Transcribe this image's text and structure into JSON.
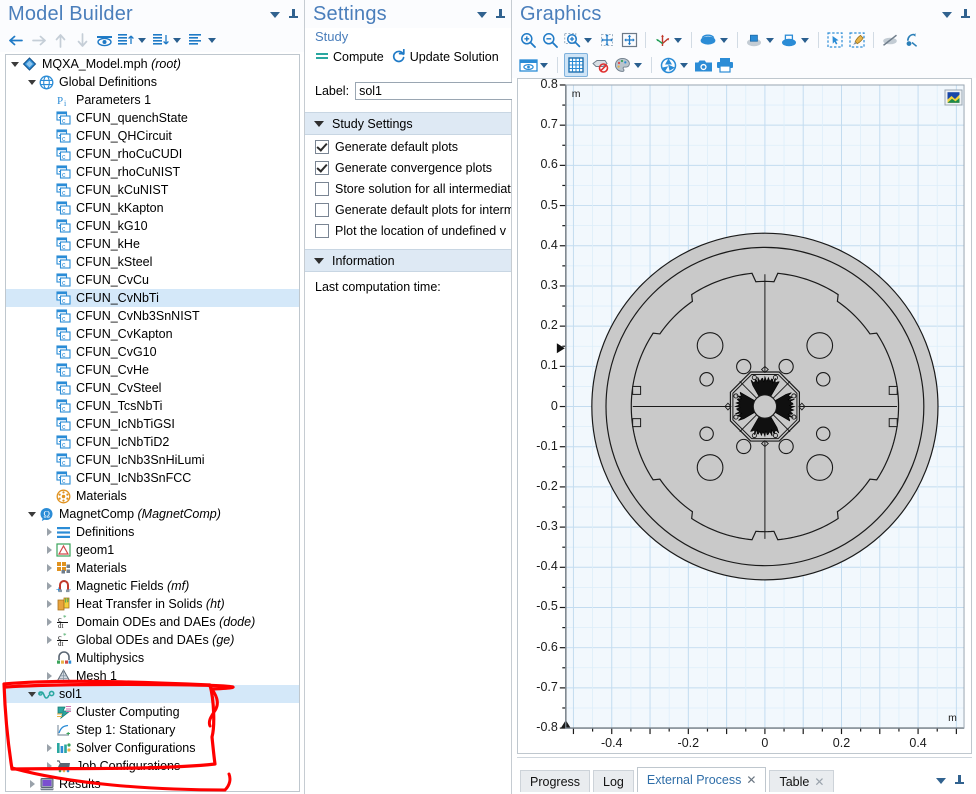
{
  "model_builder": {
    "title": "Model Builder",
    "toolbar": [
      {
        "name": "back-button",
        "icon": "arrow-left-icon"
      },
      {
        "name": "forward-button",
        "icon": "arrow-right-icon"
      },
      {
        "name": "move-up-button",
        "icon": "arrow-up-icon"
      },
      {
        "name": "move-down-button",
        "icon": "arrow-down-icon"
      },
      {
        "name": "show-hide-button",
        "icon": "eye-icon"
      },
      {
        "name": "collapse-tree-button",
        "icon": "collapse-up-icon"
      },
      {
        "name": "expand-tree-button",
        "icon": "expand-down-icon"
      },
      {
        "name": "tree-options-button",
        "icon": "list-icon"
      }
    ],
    "tree": [
      {
        "label": "MQXA_Model.mph",
        "suffix": "(root)",
        "depth": 0,
        "expander": "down",
        "icon": "root-diamond-icon",
        "selected": false
      },
      {
        "label": "Global Definitions",
        "suffix": "",
        "depth": 1,
        "expander": "down",
        "icon": "globe-icon",
        "selected": false
      },
      {
        "label": "Parameters 1",
        "suffix": "",
        "depth": 2,
        "expander": "none",
        "icon": "parameters-icon",
        "selected": false
      },
      {
        "label": "CFUN_quenchState",
        "suffix": "",
        "depth": 2,
        "expander": "none",
        "icon": "function-icon",
        "selected": false
      },
      {
        "label": "CFUN_QHCircuit",
        "suffix": "",
        "depth": 2,
        "expander": "none",
        "icon": "function-icon",
        "selected": false
      },
      {
        "label": "CFUN_rhoCuCUDI",
        "suffix": "",
        "depth": 2,
        "expander": "none",
        "icon": "function-icon",
        "selected": false
      },
      {
        "label": "CFUN_rhoCuNIST",
        "suffix": "",
        "depth": 2,
        "expander": "none",
        "icon": "function-icon",
        "selected": false
      },
      {
        "label": "CFUN_kCuNIST",
        "suffix": "",
        "depth": 2,
        "expander": "none",
        "icon": "function-icon",
        "selected": false
      },
      {
        "label": "CFUN_kKapton",
        "suffix": "",
        "depth": 2,
        "expander": "none",
        "icon": "function-icon",
        "selected": false
      },
      {
        "label": "CFUN_kG10",
        "suffix": "",
        "depth": 2,
        "expander": "none",
        "icon": "function-icon",
        "selected": false
      },
      {
        "label": "CFUN_kHe",
        "suffix": "",
        "depth": 2,
        "expander": "none",
        "icon": "function-icon",
        "selected": false
      },
      {
        "label": "CFUN_kSteel",
        "suffix": "",
        "depth": 2,
        "expander": "none",
        "icon": "function-icon",
        "selected": false
      },
      {
        "label": "CFUN_CvCu",
        "suffix": "",
        "depth": 2,
        "expander": "none",
        "icon": "function-icon",
        "selected": false
      },
      {
        "label": "CFUN_CvNbTi",
        "suffix": "",
        "depth": 2,
        "expander": "none",
        "icon": "function-icon",
        "selected": true
      },
      {
        "label": "CFUN_CvNb3SnNIST",
        "suffix": "",
        "depth": 2,
        "expander": "none",
        "icon": "function-icon",
        "selected": false
      },
      {
        "label": "CFUN_CvKapton",
        "suffix": "",
        "depth": 2,
        "expander": "none",
        "icon": "function-icon",
        "selected": false
      },
      {
        "label": "CFUN_CvG10",
        "suffix": "",
        "depth": 2,
        "expander": "none",
        "icon": "function-icon",
        "selected": false
      },
      {
        "label": "CFUN_CvHe",
        "suffix": "",
        "depth": 2,
        "expander": "none",
        "icon": "function-icon",
        "selected": false
      },
      {
        "label": "CFUN_CvSteel",
        "suffix": "",
        "depth": 2,
        "expander": "none",
        "icon": "function-icon",
        "selected": false
      },
      {
        "label": "CFUN_TcsNbTi",
        "suffix": "",
        "depth": 2,
        "expander": "none",
        "icon": "function-icon",
        "selected": false
      },
      {
        "label": "CFUN_IcNbTiGSI",
        "suffix": "",
        "depth": 2,
        "expander": "none",
        "icon": "function-icon",
        "selected": false
      },
      {
        "label": "CFUN_IcNbTiD2",
        "suffix": "",
        "depth": 2,
        "expander": "none",
        "icon": "function-icon",
        "selected": false
      },
      {
        "label": "CFUN_IcNb3SnHiLumi",
        "suffix": "",
        "depth": 2,
        "expander": "none",
        "icon": "function-icon",
        "selected": false
      },
      {
        "label": "CFUN_IcNb3SnFCC",
        "suffix": "",
        "depth": 2,
        "expander": "none",
        "icon": "function-icon",
        "selected": false
      },
      {
        "label": "Materials",
        "suffix": "",
        "depth": 2,
        "expander": "none",
        "icon": "materials-global-icon",
        "selected": false
      },
      {
        "label": "MagnetComp",
        "suffix": "(MagnetComp)",
        "depth": 1,
        "expander": "down",
        "icon": "component-icon",
        "selected": false
      },
      {
        "label": "Definitions",
        "suffix": "",
        "depth": 2,
        "expander": "right",
        "icon": "definitions-icon",
        "selected": false
      },
      {
        "label": "geom1",
        "suffix": "",
        "depth": 2,
        "expander": "right",
        "icon": "geometry-icon",
        "selected": false
      },
      {
        "label": "Materials",
        "suffix": "",
        "depth": 2,
        "expander": "right",
        "icon": "materials-icon",
        "selected": false
      },
      {
        "label": "Magnetic Fields",
        "suffix": "(mf)",
        "depth": 2,
        "expander": "right",
        "icon": "magnetic-fields-icon",
        "selected": false
      },
      {
        "label": "Heat Transfer in Solids",
        "suffix": "(ht)",
        "depth": 2,
        "expander": "right",
        "icon": "heat-transfer-icon",
        "selected": false
      },
      {
        "label": "Domain ODEs and DAEs",
        "suffix": "(dode)",
        "depth": 2,
        "expander": "right",
        "icon": "ode-icon",
        "selected": false
      },
      {
        "label": "Global ODEs and DAEs",
        "suffix": "(ge)",
        "depth": 2,
        "expander": "right",
        "icon": "ode-icon",
        "selected": false
      },
      {
        "label": "Multiphysics",
        "suffix": "",
        "depth": 2,
        "expander": "none",
        "icon": "multiphysics-icon",
        "selected": false
      },
      {
        "label": "Mesh 1",
        "suffix": "",
        "depth": 2,
        "expander": "right",
        "icon": "mesh-icon",
        "selected": false
      },
      {
        "label": "sol1",
        "suffix": "",
        "depth": 1,
        "expander": "down",
        "icon": "solution-icon",
        "selected": true
      },
      {
        "label": "Cluster Computing",
        "suffix": "",
        "depth": 2,
        "expander": "none",
        "icon": "cluster-computing-icon",
        "selected": false
      },
      {
        "label": " Step 1: Stationary",
        "suffix": "",
        "depth": 2,
        "expander": "none",
        "icon": "stationary-step-icon",
        "selected": false
      },
      {
        "label": "Solver Configurations",
        "suffix": "",
        "depth": 2,
        "expander": "right",
        "icon": "solver-configurations-icon",
        "selected": false
      },
      {
        "label": "Job Configurations",
        "suffix": "",
        "depth": 2,
        "expander": "right",
        "icon": "job-configurations-icon",
        "selected": false
      },
      {
        "label": "Results",
        "suffix": "",
        "depth": 1,
        "expander": "right",
        "icon": "results-icon",
        "selected": false
      }
    ]
  },
  "settings": {
    "title": "Settings",
    "subtitle": "Study",
    "actions": [
      {
        "label": "Compute",
        "icon": "compute-icon"
      },
      {
        "label": "Update Solution",
        "icon": "update-solution-icon"
      }
    ],
    "label_caption": "Label:",
    "label_value": "sol1",
    "label_placeholder": "Label",
    "sections": [
      {
        "title": "Study Settings",
        "checkboxes": [
          {
            "label": "Generate default plots",
            "checked": true
          },
          {
            "label": "Generate convergence plots",
            "checked": true
          },
          {
            "label": "Store solution for all intermediate",
            "checked": false
          },
          {
            "label": "Generate default plots for interm",
            "checked": false
          },
          {
            "label": "Plot the location of undefined v",
            "checked": false
          }
        ]
      },
      {
        "title": "Information",
        "info_text": "Last computation time:"
      }
    ]
  },
  "graphics": {
    "title": "Graphics",
    "toolbar_row1": [
      {
        "name": "zoom-in-button",
        "icon": "zoom-in-icon"
      },
      {
        "name": "zoom-out-button",
        "icon": "zoom-out-icon"
      },
      {
        "name": "zoom-box-button",
        "icon": "zoom-box-icon"
      },
      {
        "name": "zoom-extents-button",
        "icon": "zoom-extents-icon"
      },
      {
        "name": "zoom-to-selection-button",
        "icon": "zoom-selection-icon"
      },
      {
        "name": "view-orientation-button",
        "icon": "axes-orientation-icon"
      },
      {
        "name": "scene-light-button",
        "icon": "scene-light-icon"
      },
      {
        "name": "transparency-button",
        "icon": "transparency-icon"
      },
      {
        "name": "wireframe-button",
        "icon": "wireframe-icon"
      },
      {
        "name": "select-box-button",
        "icon": "select-box-icon"
      },
      {
        "name": "select-brush-button",
        "icon": "select-brush-icon"
      },
      {
        "name": "hide-geometry-button",
        "icon": "hide-geometry-icon"
      },
      {
        "name": "reset-hiding-button",
        "icon": "reset-hiding-icon"
      }
    ],
    "toolbar_row2": [
      {
        "name": "show-grid-button",
        "icon": "show-grid-icon"
      },
      {
        "name": "grid-toggle-button",
        "icon": "grid-icon"
      },
      {
        "name": "clear-plot-button",
        "icon": "clear-plot-icon"
      },
      {
        "name": "color-legend-button",
        "icon": "color-palette-icon"
      },
      {
        "name": "camera-settings-button",
        "icon": "aperture-icon"
      },
      {
        "name": "snapshot-button",
        "icon": "camera-icon"
      },
      {
        "name": "print-button",
        "icon": "printer-icon"
      }
    ],
    "chart_data": {
      "type": "scatter",
      "title": "",
      "xlabel": "m",
      "ylabel": "m",
      "xlim": [
        -0.52,
        0.52
      ],
      "ylim": [
        -0.8,
        0.8
      ],
      "xticks": [
        -0.4,
        -0.2,
        0,
        0.2,
        0.4
      ],
      "xtick_labels": [
        "-0.4",
        "-0.2",
        "0",
        "0.2",
        "0.4"
      ],
      "yticks": [
        0.8,
        0.7,
        0.6,
        0.5,
        0.4,
        0.3,
        0.2,
        0.1,
        0,
        -0.1,
        -0.2,
        -0.3,
        -0.4,
        -0.5,
        -0.6,
        -0.7,
        -0.8
      ],
      "ytick_labels": [
        "0.8",
        "0.7",
        "0.6",
        "0.5",
        "0.4",
        "0.3",
        "0.2",
        "0.1",
        "0",
        "-0.1",
        "-0.2",
        "-0.3",
        "-0.4",
        "-0.5",
        "-0.6",
        "-0.7",
        "-0.8"
      ],
      "grid": true,
      "unit_label_top": "m",
      "unit_label_bottom": "m",
      "background_color": "#f2f8fd",
      "grid_color": "#cfe3f2",
      "geometry_fill": "#c9c9c9",
      "geometry_stroke": "#1a1a1a",
      "annotation": "MQXA quadrupole magnet 2D cross-section: outer iron yoke circle with keyway notches, inner collar octagon, and four superconducting coil blocks around the central aperture."
    }
  },
  "bottom_panel": {
    "tabs": [
      {
        "label": "Progress",
        "active": false,
        "closable": false
      },
      {
        "label": "Log",
        "active": false,
        "closable": false
      },
      {
        "label": "External Process",
        "active": true,
        "closable": true
      },
      {
        "label": "Table",
        "active": false,
        "closable": true
      }
    ],
    "close_glyph": "✕"
  },
  "annotation": {
    "type": "hand-drawn-red-box",
    "color": "#ff0000",
    "note": "Red highlight around sol1 solver node group"
  }
}
